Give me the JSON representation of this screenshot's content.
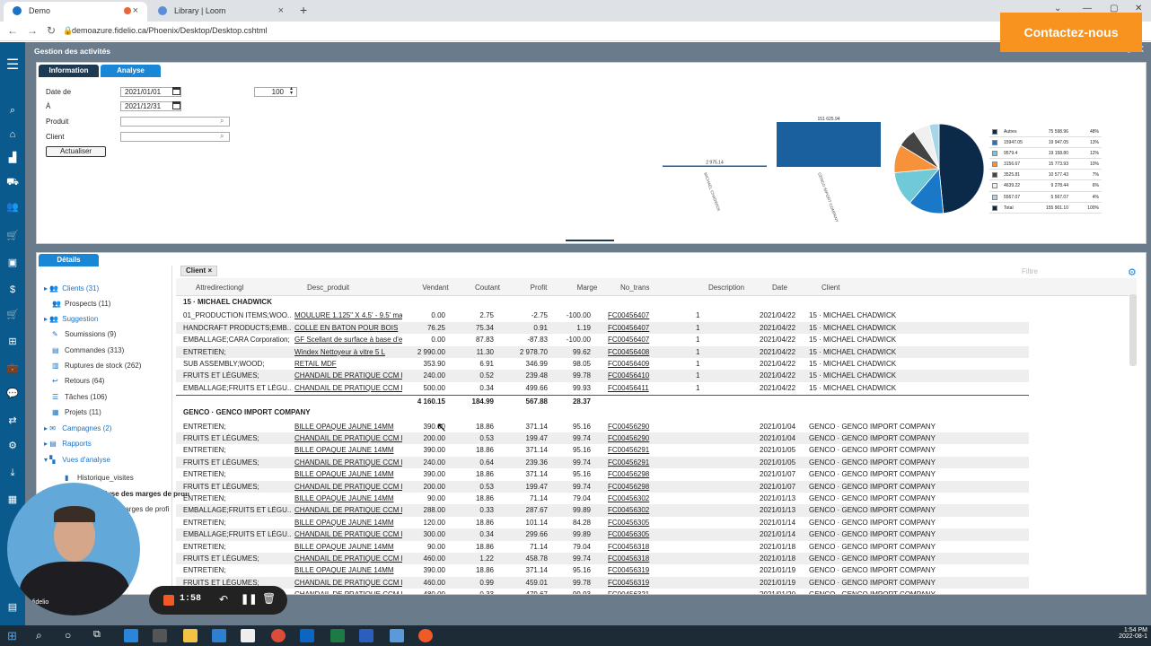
{
  "browser": {
    "tabs": [
      {
        "label": "Demo"
      },
      {
        "label": "Library | Loom"
      }
    ],
    "url": "demoazure.fidelio.ca/Phoenix/Desktop/Desktop.cshtml"
  },
  "cta": {
    "label": "Contactez-nous"
  },
  "app": {
    "title": "Gestion des activités"
  },
  "panel_tabs": [
    "Information",
    "Analyse"
  ],
  "filters": {
    "date_from_label": "Date de",
    "date_from": "2021/01/01",
    "date_to_label": "À",
    "date_to": "2021/12/31",
    "count": "100",
    "product_label": "Produit",
    "client_label": "Client",
    "refresh": "Actualiser"
  },
  "chart_data": [
    {
      "type": "bar",
      "categories": [
        "MICHAEL CHADWICK",
        "GENCO IMPORT COMPANY"
      ],
      "values": [
        2975.14,
        151625.94
      ],
      "data_labels": [
        "2 975.14",
        "151 625.94"
      ]
    },
    {
      "type": "pie",
      "series": [
        {
          "values": [
            75598.96,
            19947.05,
            19158.8,
            15773.93,
            10577.43,
            9278.44,
            5567.07
          ],
          "colors": [
            "#0b2a4a",
            "#1a78c8",
            "#6fc9d6",
            "#f7923a",
            "#444444",
            "#f0f0f0",
            "#a8d5e8"
          ]
        }
      ],
      "legend": [
        {
          "color": "#0b2a4a",
          "c1": "Autres",
          "c2": "75 598.96",
          "c3": "48%"
        },
        {
          "color": "#1a78c8",
          "c1": "15947.05",
          "c2": "19 947.05",
          "c3": "13%"
        },
        {
          "color": "#6fc9d6",
          "c1": "9579.4",
          "c2": "19 158.80",
          "c3": "12%"
        },
        {
          "color": "#f7923a",
          "c1": "3156.67",
          "c2": "15 773.93",
          "c3": "10%"
        },
        {
          "color": "#444444",
          "c1": "3525.81",
          "c2": "10 577.43",
          "c3": "7%"
        },
        {
          "color": "#f0f0f0",
          "c1": "4639.22",
          "c2": "9 278.44",
          "c3": "6%"
        },
        {
          "color": "#a8d5e8",
          "c1": "5567.07",
          "c2": "5 567.07",
          "c3": "4%"
        },
        {
          "color": "#0b2a4a",
          "c1": "Total",
          "c2": "155 901.10",
          "c3": "100%"
        }
      ]
    }
  ],
  "details": {
    "tab": "Détails",
    "chip": "Client ×",
    "filter_placeholder": "Filtre"
  },
  "tree": [
    {
      "label": "Clients (31)",
      "link": true,
      "arrow": true,
      "icon": "👥"
    },
    {
      "label": "Prospects (11)",
      "link": false,
      "arrow": false,
      "icon": "👥"
    },
    {
      "label": "Suggestion",
      "link": true,
      "arrow": true,
      "icon": "👥"
    },
    {
      "label": "Soumissions (9)",
      "link": false,
      "arrow": false,
      "icon": "✎"
    },
    {
      "label": "Commandes (313)",
      "link": false,
      "arrow": false,
      "icon": "▤"
    },
    {
      "label": "Ruptures de stock (262)",
      "link": false,
      "arrow": false,
      "icon": "▥"
    },
    {
      "label": "Retours (64)",
      "link": false,
      "arrow": false,
      "icon": "↩"
    },
    {
      "label": "Tâches (106)",
      "link": false,
      "arrow": false,
      "icon": "☰"
    },
    {
      "label": "Projets (11)",
      "link": false,
      "arrow": false,
      "icon": "▦"
    },
    {
      "label": "Campagnes (2)",
      "link": true,
      "arrow": true,
      "icon": "✉"
    },
    {
      "label": "Rapports",
      "link": true,
      "arrow": true,
      "icon": "▤"
    },
    {
      "label": "Vues d'analyse",
      "link": true,
      "arrow": true,
      "icon": "▚"
    },
    {
      "label": "Historique_visites",
      "link": false,
      "arrow": false,
      "icon": "▮"
    },
    {
      "label": "Analyse des marges de profi",
      "link": false,
      "arrow": false,
      "icon": ""
    },
    {
      "label": "Analyse marges de profi",
      "link": false,
      "arrow": false,
      "icon": ""
    }
  ],
  "grid": {
    "headers": [
      "Attredirectiongl",
      "Desc_produit",
      "Vendant",
      "Coutant",
      "Profit",
      "Marge",
      "No_trans",
      "Description",
      "Date",
      "Client"
    ],
    "groups": [
      {
        "title": "15 · MICHAEL CHADWICK",
        "rows": [
          [
            "01_PRODUCTION ITEMS;WOO...",
            "MOULURE 1.125\" X 4.5' - 9.5' ma...",
            "0.00",
            "2.75",
            "-2.75",
            "-100.00",
            "FC00456407",
            "1",
            "2021/04/22",
            "15 · MICHAEL CHADWICK"
          ],
          [
            "HANDCRAFT PRODUCTS;EMB...",
            "COLLE EN BATON POUR BOIS",
            "76.25",
            "75.34",
            "0.91",
            "1.19",
            "FC00456407",
            "1",
            "2021/04/22",
            "15 · MICHAEL CHADWICK"
          ],
          [
            "EMBALLAGE;CARA Corporation;",
            "GF Scellant de surface à base d'e...",
            "0.00",
            "87.83",
            "-87.83",
            "-100.00",
            "FC00456407",
            "1",
            "2021/04/22",
            "15 · MICHAEL CHADWICK"
          ],
          [
            "ENTRETIEN;",
            "Windex Nettoyeur à vitre 5 L",
            "2 990.00",
            "11.30",
            "2 978.70",
            "99.62",
            "FC00456408",
            "1",
            "2021/04/22",
            "15 · MICHAEL CHADWICK"
          ],
          [
            "SUB ASSEMBLY;WOOD;",
            "RETAIL MDF",
            "353.90",
            "6.91",
            "346.99",
            "98.05",
            "FC00456409",
            "1",
            "2021/04/22",
            "15 · MICHAEL CHADWICK"
          ],
          [
            "FRUITS ET LÉGUMES;",
            "CHANDAIL DE PRATIQUE CCM R...",
            "240.00",
            "0.52",
            "239.48",
            "99.78",
            "FC00456410",
            "1",
            "2021/04/22",
            "15 · MICHAEL CHADWICK"
          ],
          [
            "EMBALLAGE;FRUITS ET LÉGU...",
            "CHANDAIL DE PRATIQUE CCM R...",
            "500.00",
            "0.34",
            "499.66",
            "99.93",
            "FC00456411",
            "1",
            "2021/04/22",
            "15 · MICHAEL CHADWICK"
          ]
        ],
        "totals": [
          "4 160.15",
          "184.99",
          "567.88",
          "28.37"
        ]
      },
      {
        "title": "GENCO · GENCO IMPORT COMPANY",
        "rows": [
          [
            "ENTRETIEN;",
            "BILLE OPAQUE JAUNE 14MM",
            "390.00",
            "18.86",
            "371.14",
            "95.16",
            "FC00456290",
            "",
            "2021/01/04",
            "GENCO · GENCO IMPORT COMPANY"
          ],
          [
            "FRUITS ET LÉGUMES;",
            "CHANDAIL DE PRATIQUE CCM R...",
            "200.00",
            "0.53",
            "199.47",
            "99.74",
            "FC00456290",
            "",
            "2021/01/04",
            "GENCO · GENCO IMPORT COMPANY"
          ],
          [
            "ENTRETIEN;",
            "BILLE OPAQUE JAUNE 14MM",
            "390.00",
            "18.86",
            "371.14",
            "95.16",
            "FC00456291",
            "",
            "2021/01/05",
            "GENCO · GENCO IMPORT COMPANY"
          ],
          [
            "FRUITS ET LÉGUMES;",
            "CHANDAIL DE PRATIQUE CCM R...",
            "240.00",
            "0.64",
            "239.36",
            "99.74",
            "FC00456291",
            "",
            "2021/01/05",
            "GENCO · GENCO IMPORT COMPANY"
          ],
          [
            "ENTRETIEN;",
            "BILLE OPAQUE JAUNE 14MM",
            "390.00",
            "18.86",
            "371.14",
            "95.16",
            "FC00456298",
            "",
            "2021/01/07",
            "GENCO · GENCO IMPORT COMPANY"
          ],
          [
            "FRUITS ET LÉGUMES;",
            "CHANDAIL DE PRATIQUE CCM R...",
            "200.00",
            "0.53",
            "199.47",
            "99.74",
            "FC00456298",
            "",
            "2021/01/07",
            "GENCO · GENCO IMPORT COMPANY"
          ],
          [
            "ENTRETIEN;",
            "BILLE OPAQUE JAUNE 14MM",
            "90.00",
            "18.86",
            "71.14",
            "79.04",
            "FC00456302",
            "",
            "2021/01/13",
            "GENCO · GENCO IMPORT COMPANY"
          ],
          [
            "EMBALLAGE;FRUITS ET LÉGU...",
            "CHANDAIL DE PRATIQUE CCM R...",
            "288.00",
            "0.33",
            "287.67",
            "99.89",
            "FC00456302",
            "",
            "2021/01/13",
            "GENCO · GENCO IMPORT COMPANY"
          ],
          [
            "ENTRETIEN;",
            "BILLE OPAQUE JAUNE 14MM",
            "120.00",
            "18.86",
            "101.14",
            "84.28",
            "FC00456305",
            "",
            "2021/01/14",
            "GENCO · GENCO IMPORT COMPANY"
          ],
          [
            "EMBALLAGE;FRUITS ET LÉGU...",
            "CHANDAIL DE PRATIQUE CCM R...",
            "300.00",
            "0.34",
            "299.66",
            "99.89",
            "FC00456305",
            "",
            "2021/01/14",
            "GENCO · GENCO IMPORT COMPANY"
          ],
          [
            "ENTRETIEN;",
            "BILLE OPAQUE JAUNE 14MM",
            "90.00",
            "18.86",
            "71.14",
            "79.04",
            "FC00456318",
            "",
            "2021/01/18",
            "GENCO · GENCO IMPORT COMPANY"
          ],
          [
            "FRUITS ET LÉGUMES;",
            "CHANDAIL DE PRATIQUE CCM R...",
            "460.00",
            "1.22",
            "458.78",
            "99.74",
            "FC00456318",
            "",
            "2021/01/18",
            "GENCO · GENCO IMPORT COMPANY"
          ],
          [
            "ENTRETIEN;",
            "BILLE OPAQUE JAUNE 14MM",
            "390.00",
            "18.86",
            "371.14",
            "95.16",
            "FC00456319",
            "",
            "2021/01/19",
            "GENCO · GENCO IMPORT COMPANY"
          ],
          [
            "FRUITS ET LÉGUMES;",
            "CHANDAIL DE PRATIQUE CCM R...",
            "460.00",
            "0.99",
            "459.01",
            "99.78",
            "FC00456319",
            "",
            "2021/01/19",
            "GENCO · GENCO IMPORT COMPANY"
          ],
          [
            "",
            "CHANDAIL DE PRATIQUE CCM R...",
            "480.00",
            "0.33",
            "479.67",
            "99.93",
            "FC00456321",
            "",
            "2021/01/20",
            "GENCO · GENCO IMPORT COMPANY"
          ]
        ]
      }
    ]
  },
  "recorder": {
    "time": "1:58"
  },
  "clock": {
    "time": "1:54 PM",
    "date": "2022-08-1"
  },
  "video": {
    "logo": "fidelio"
  }
}
